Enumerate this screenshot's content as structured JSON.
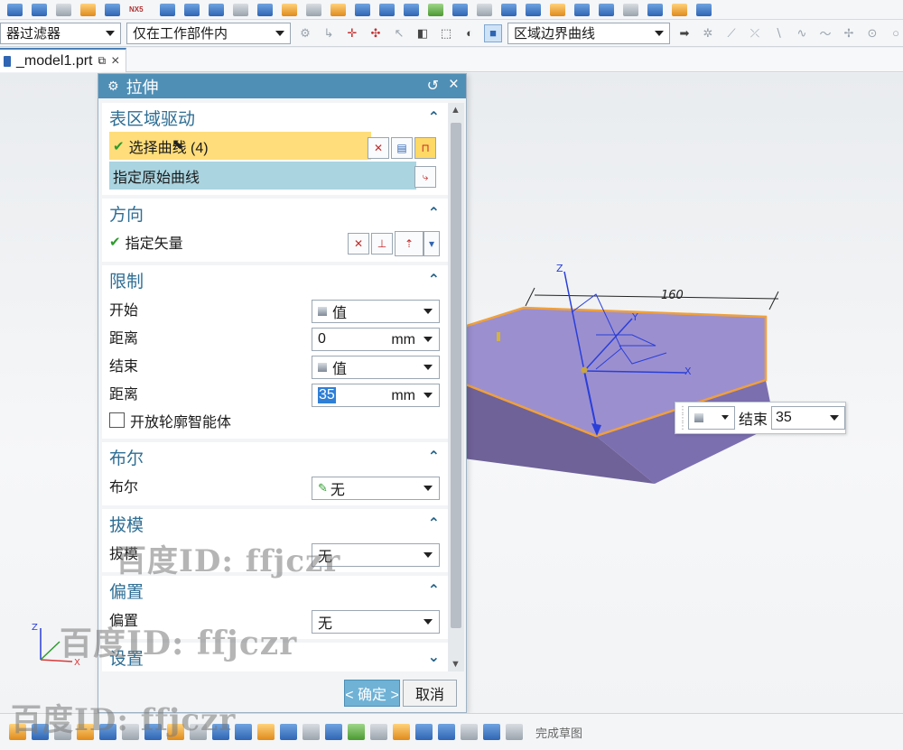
{
  "toolbar": {
    "filter_type": "器过滤器",
    "filter_scope": "仅在工作部件内",
    "curve_rule": "区域边界曲线",
    "brand_tag": "NX5"
  },
  "tab": {
    "file_name": "_model1.prt"
  },
  "dialog": {
    "title": "拉伸",
    "groups": {
      "section": {
        "title": "表区域驱动",
        "select_curve": "选择曲线 (4)",
        "specify_origin_curve": "指定原始曲线"
      },
      "direction": {
        "title": "方向",
        "specify_vector": "指定矢量"
      },
      "limits": {
        "title": "限制",
        "start_label": "开始",
        "start_value": "值",
        "start_distance_label": "距离",
        "start_distance": "0",
        "start_unit": "mm",
        "end_label": "结束",
        "end_value": "值",
        "end_distance_label": "距离",
        "end_distance": "35",
        "end_unit": "mm",
        "open_profile": "开放轮廓智能体"
      },
      "boolean": {
        "title": "布尔",
        "label": "布尔",
        "value": "无"
      },
      "draft": {
        "title": "拔模",
        "label": "拔模",
        "value": "无"
      },
      "offset": {
        "title": "偏置",
        "label": "偏置",
        "value": "无"
      },
      "settings": {
        "title": "设置"
      }
    },
    "ok": "< 确定 >",
    "cancel": "取消"
  },
  "viewport": {
    "dimension": "160",
    "axis_z": "Z",
    "axis_x": "X",
    "axis_y": "Y",
    "triad_z": "Z",
    "triad_x": "X"
  },
  "onscreen_input": {
    "label": "结束",
    "value": "35"
  },
  "bottom": {
    "finish_sketch": "完成草图"
  },
  "watermarks": [
    "百度ID: ffjczr",
    "百度ID: ffjczr",
    "百度ID: ffjczr"
  ],
  "colors": {
    "dialog_title": "#4f8fb6",
    "group_title": "#2e6e94",
    "selection_highlight": "#ffdd7a",
    "selected_row": "#a9d4e0",
    "solid_fill": "#8f80c4",
    "edge_highlight": "#f0a03c"
  }
}
